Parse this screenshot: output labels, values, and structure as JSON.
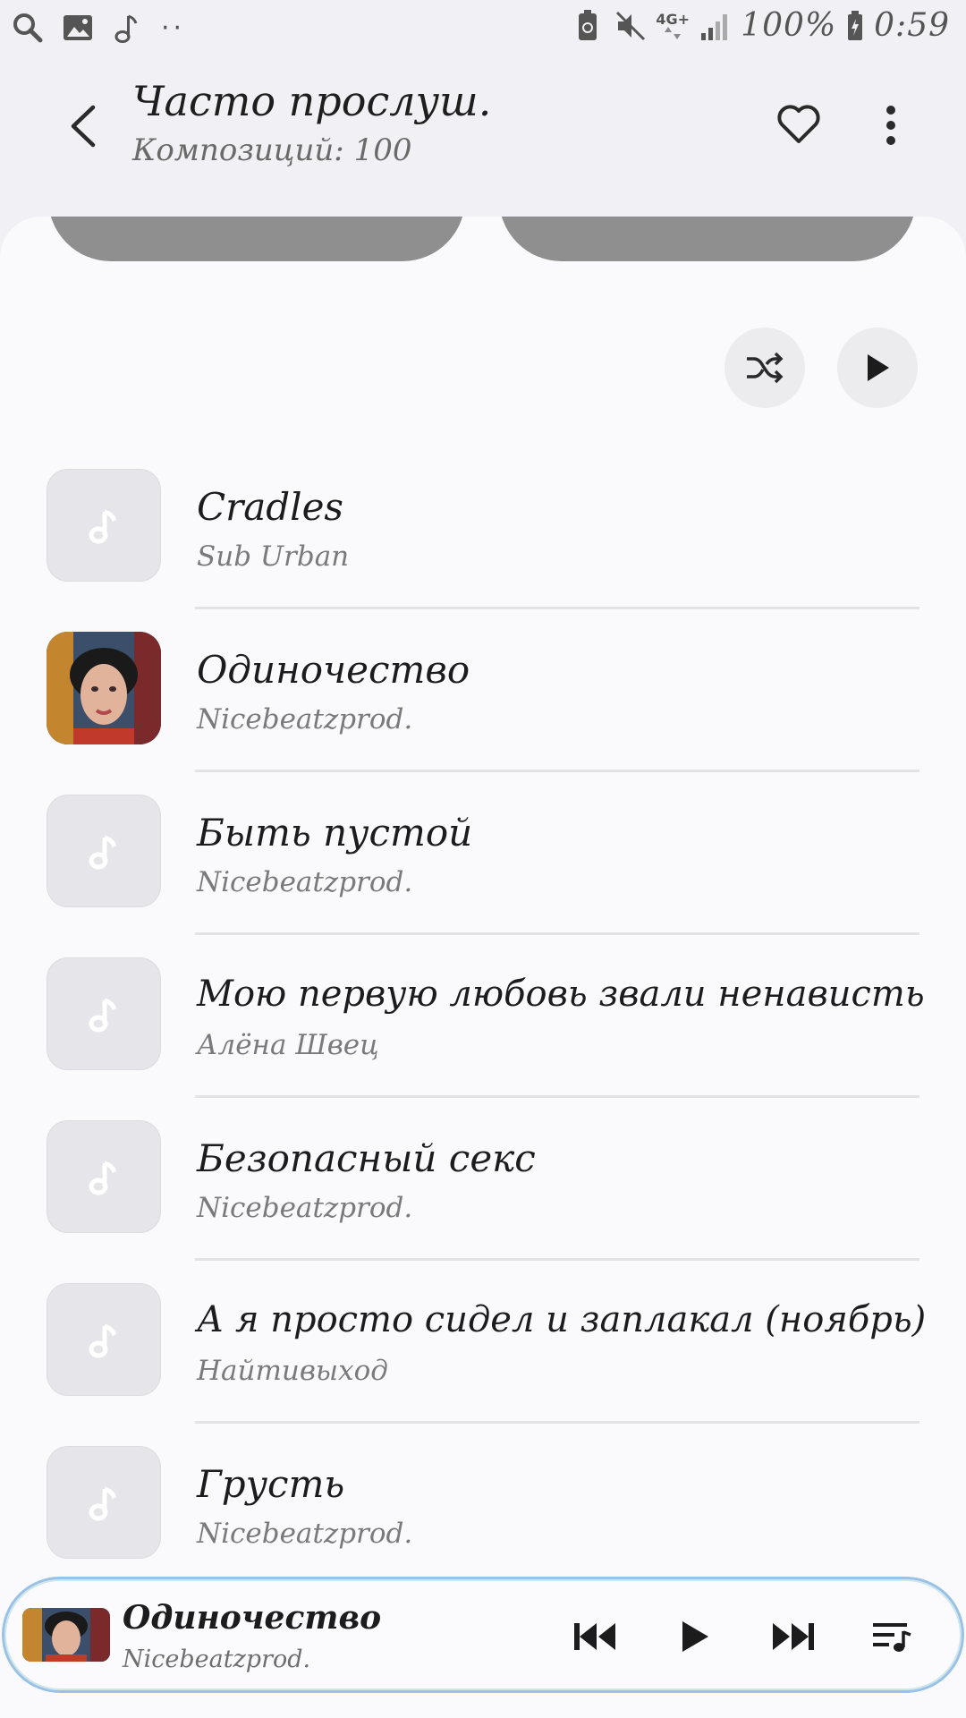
{
  "status_bar": {
    "left_icons": [
      "search-icon",
      "gallery-icon",
      "music-note-icon"
    ],
    "overflow_dots": "··",
    "network": "4G+",
    "battery_percent": "100%",
    "time": "0:59"
  },
  "header": {
    "title": "Часто прослуш.",
    "subtitle": "Композиций: 100"
  },
  "tracks": [
    {
      "title": "Cradles",
      "artist": "Sub Urban",
      "has_artwork": false
    },
    {
      "title": "Одиночество",
      "artist": "Nicebeatzprod.",
      "has_artwork": true
    },
    {
      "title": "Быть пустой",
      "artist": "Nicebeatzprod.",
      "has_artwork": false
    },
    {
      "title": "Мою первую любовь звали ненависть",
      "artist": "Алёна Швец",
      "has_artwork": false
    },
    {
      "title": "Безопасный секс",
      "artist": "Nicebeatzprod.",
      "has_artwork": false
    },
    {
      "title": "А я просто сидел и заплакал (ноябрь)",
      "artist": "Найтивыход",
      "has_artwork": false
    },
    {
      "title": "Грусть",
      "artist": "Nicebeatzprod.",
      "has_artwork": false
    }
  ],
  "mini_player": {
    "title": "Одиночество",
    "artist": "Nicebeatzprod."
  },
  "colors": {
    "background": "#f1f0f4",
    "card": "#fafafc",
    "chip": "#8f8f8f",
    "accent_border": "#9ac2e6"
  }
}
